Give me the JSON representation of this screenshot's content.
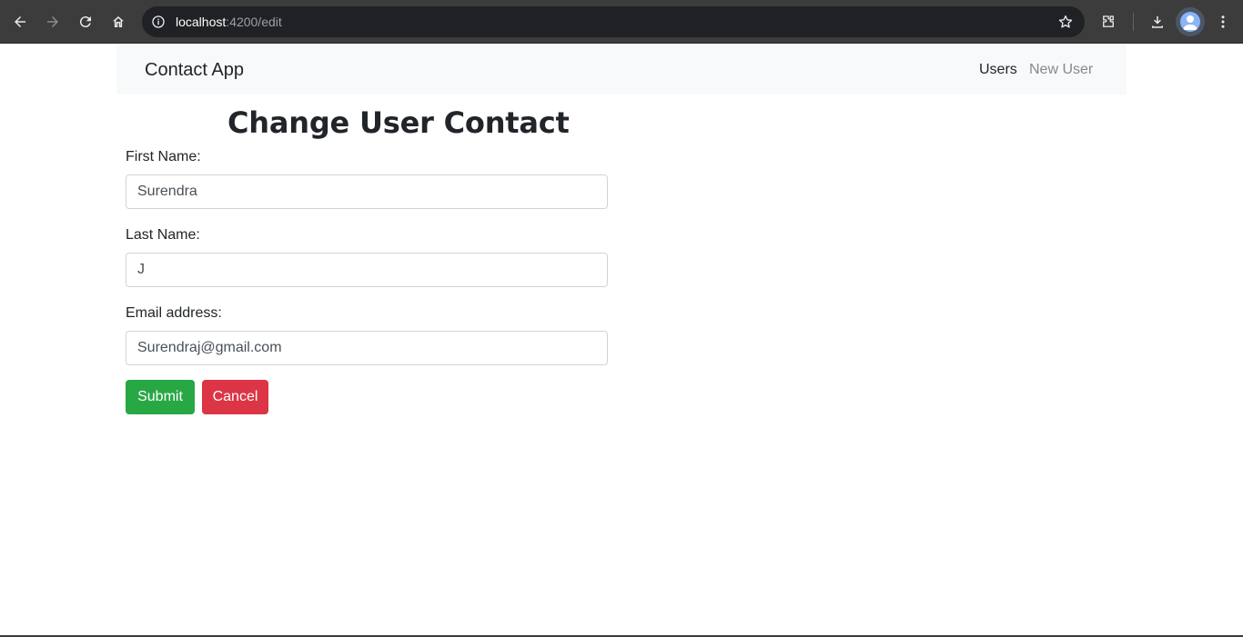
{
  "browser": {
    "url_host": "localhost",
    "url_path": ":4200/edit"
  },
  "navbar": {
    "brand": "Contact App",
    "links": [
      {
        "label": "Users"
      },
      {
        "label": "New User"
      }
    ]
  },
  "form": {
    "title": "Change User Contact",
    "first_name": {
      "label": "First Name:",
      "value": "Surendra"
    },
    "last_name": {
      "label": "Last Name:",
      "value": "J"
    },
    "email": {
      "label": "Email address:",
      "value": "Surendraj@gmail.com"
    },
    "submit_label": "Submit",
    "cancel_label": "Cancel"
  },
  "colors": {
    "submit": "#28a745",
    "cancel": "#dc3545",
    "navbar_bg": "#f8f9fa"
  }
}
